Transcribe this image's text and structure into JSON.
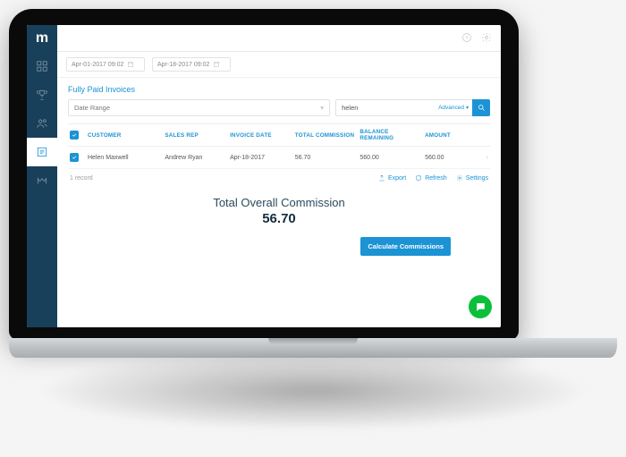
{
  "brand": "m",
  "dates": {
    "from": "Apr-01-2017 09:02",
    "to": "Apr-18-2017 09:02"
  },
  "section_title": "Fully Paid Invoices",
  "filters": {
    "dropdown_label": "Date Range",
    "search_value": "helen",
    "advanced_label": "Advanced"
  },
  "table": {
    "headers": {
      "customer": "CUSTOMER",
      "sales_rep": "SALES REP",
      "invoice_date": "INVOICE DATE",
      "total_commission": "TOTAL COMMISSION",
      "balance_remaining": "BALANCE REMAINING",
      "amount": "AMOUNT"
    },
    "rows": [
      {
        "customer": "Helen Maxwell",
        "sales_rep": "Andrew Ryan",
        "invoice_date": "Apr-18-2017",
        "total_commission": "56.70",
        "balance_remaining": "560.00",
        "amount": "560.00"
      }
    ],
    "record_count_label": "1 record"
  },
  "actions": {
    "export": "Export",
    "refresh": "Refresh",
    "settings": "Settings"
  },
  "totals": {
    "label": "Total Overall Commission",
    "value": "56.70"
  },
  "calc_button": "Calculate Commissions"
}
